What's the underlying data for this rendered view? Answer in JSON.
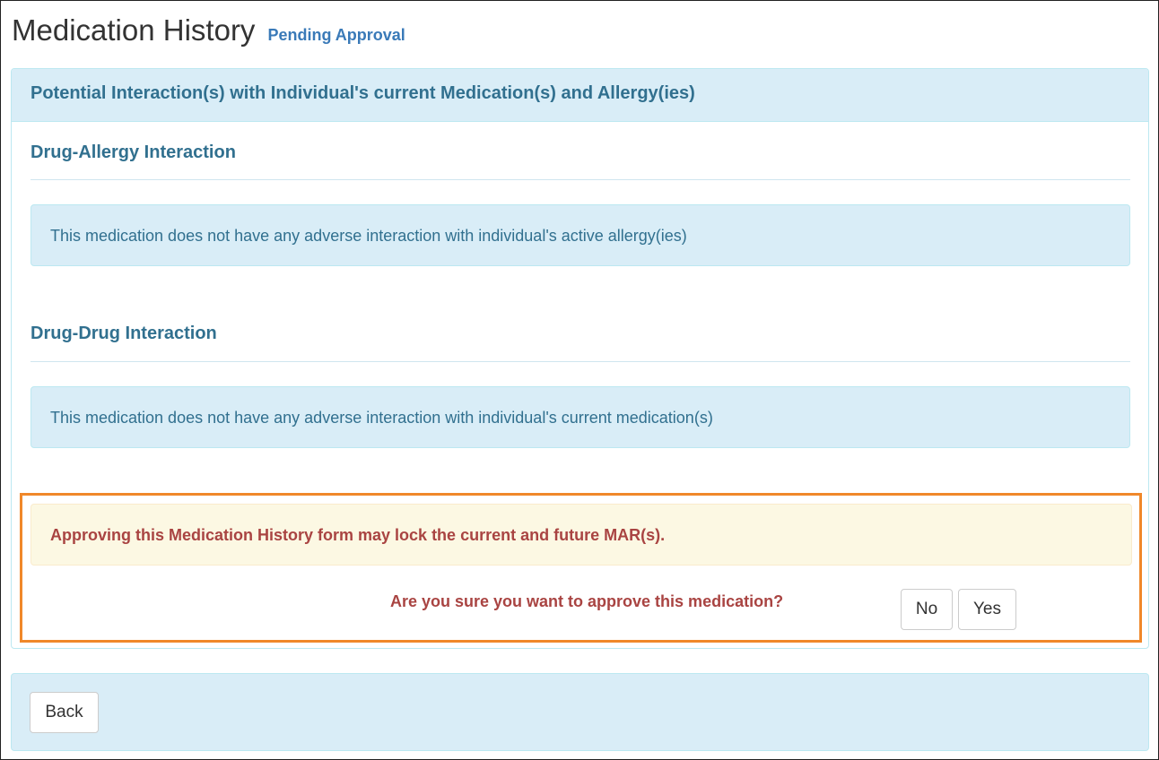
{
  "page": {
    "title": "Medication History",
    "status": "Pending Approval"
  },
  "panel": {
    "heading": "Potential Interaction(s) with Individual's current Medication(s) and Allergy(ies)",
    "drug_allergy": {
      "title": "Drug-Allergy Interaction",
      "message": "This medication does not have any adverse interaction with individual's active allergy(ies)"
    },
    "drug_drug": {
      "title": "Drug-Drug Interaction",
      "message": "This medication does not have any adverse interaction with individual's current medication(s)"
    }
  },
  "confirm": {
    "warning": "Approving this Medication History form may lock the current and future MAR(s).",
    "question": "Are you sure you want to approve this medication?",
    "no_label": "No",
    "yes_label": "Yes"
  },
  "footer": {
    "back_label": "Back"
  },
  "colors": {
    "info_bg": "#d9edf7",
    "info_text": "#31708f",
    "warning_bg": "#fcf8e3",
    "danger_text": "#a94442",
    "highlight_border": "#f0882a",
    "status_text": "#3a7ab8"
  }
}
